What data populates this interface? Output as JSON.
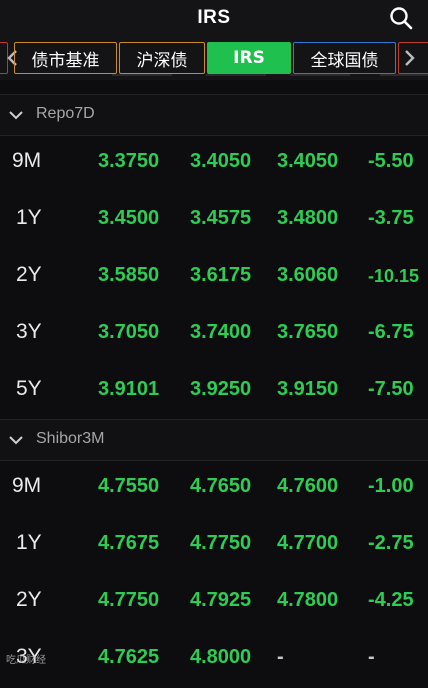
{
  "header": {
    "title": "IRS",
    "search_icon": "search-icon"
  },
  "tabs": [
    {
      "label": "债市基准"
    },
    {
      "label": "沪深债"
    },
    {
      "label": "IRS"
    },
    {
      "label": "全球国债"
    }
  ],
  "sections": [
    {
      "label": "Repo7D",
      "rows": [
        {
          "tenor": "9M",
          "v1": "3.3750",
          "v2": "3.4050",
          "v3": "3.4050",
          "v4": "-5.50"
        },
        {
          "tenor": "1Y",
          "v1": "3.4500",
          "v2": "3.4575",
          "v3": "3.4800",
          "v4": "-3.75"
        },
        {
          "tenor": "2Y",
          "v1": "3.5850",
          "v2": "3.6175",
          "v3": "3.6060",
          "v4": "-10.15"
        },
        {
          "tenor": "3Y",
          "v1": "3.7050",
          "v2": "3.7400",
          "v3": "3.7650",
          "v4": "-6.75"
        },
        {
          "tenor": "5Y",
          "v1": "3.9101",
          "v2": "3.9250",
          "v3": "3.9150",
          "v4": "-7.50"
        }
      ]
    },
    {
      "label": "Shibor3M",
      "rows": [
        {
          "tenor": "9M",
          "v1": "4.7550",
          "v2": "4.7650",
          "v3": "4.7600",
          "v4": "-1.00"
        },
        {
          "tenor": "1Y",
          "v1": "4.7675",
          "v2": "4.7750",
          "v3": "4.7700",
          "v4": "-2.75"
        },
        {
          "tenor": "2Y",
          "v1": "4.7750",
          "v2": "4.7925",
          "v3": "4.7800",
          "v4": "-4.25"
        },
        {
          "tenor": "3Y",
          "v1": "4.7625",
          "v2": "4.8000",
          "v3": "-",
          "v4": "-"
        }
      ]
    }
  ],
  "watermark": "吃瓜财经",
  "colors": {
    "accent_green": "#1fc04d",
    "value_green": "#2ecc55",
    "tab_border_orange": "#c98a2e",
    "tab_border_blue": "#2f7ad6",
    "edge_red": "#c0392b",
    "background": "#0d0d0f"
  }
}
